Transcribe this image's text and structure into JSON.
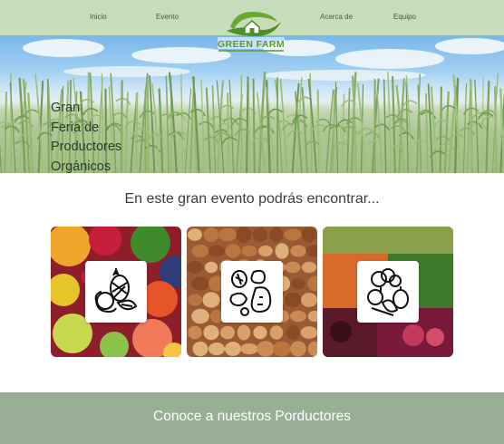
{
  "header": {
    "nav": [
      "Inicio",
      "Evento",
      "Acerca de",
      "Equipo"
    ],
    "logo_text": "GREEN FARM"
  },
  "hero": {
    "title_lines": [
      "Gran",
      "Feria de",
      "Productores",
      "Orgánicos"
    ]
  },
  "section": {
    "subtitle": "En este gran evento podrás encontrar...",
    "cards": [
      {
        "icon": "fruits-icon"
      },
      {
        "icon": "nuts-seeds-icon"
      },
      {
        "icon": "vegetables-icon"
      }
    ]
  },
  "footer": {
    "cta": "Conoce a nuestros Porductores"
  },
  "colors": {
    "header_bg": "#c6dcba",
    "footer_bg": "#98af95",
    "logo_green": "#5a9a2c"
  }
}
